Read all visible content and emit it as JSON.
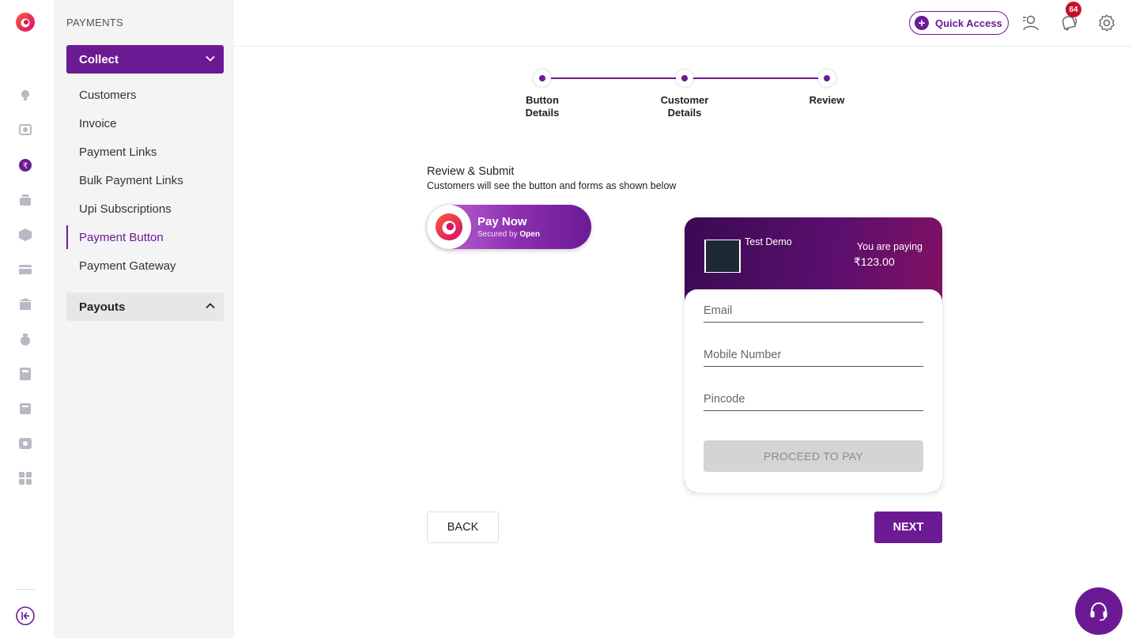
{
  "sidebar": {
    "heading": "PAYMENTS",
    "collect_label": "Collect",
    "items": [
      {
        "label": "Customers"
      },
      {
        "label": "Invoice"
      },
      {
        "label": "Payment Links"
      },
      {
        "label": "Bulk Payment Links"
      },
      {
        "label": "Upi Subscriptions"
      },
      {
        "label": "Payment Button",
        "active": true
      },
      {
        "label": "Payment Gateway"
      }
    ],
    "payouts_label": "Payouts"
  },
  "rail": {
    "icons": [
      "bulb-icon",
      "search-profile-icon",
      "rupee-icon",
      "basket-icon",
      "box-icon",
      "card-icon",
      "bank-icon",
      "money-bag-icon",
      "calculator-icon",
      "ledger-icon",
      "reward-icon",
      "grid-icon"
    ],
    "active_icon": "rupee-icon"
  },
  "topbar": {
    "quick_access_label": "Quick Access",
    "notification_count": "64"
  },
  "stepper": {
    "steps": [
      {
        "label_line1": "Button",
        "label_line2": "Details"
      },
      {
        "label_line1": "Customer",
        "label_line2": "Details"
      },
      {
        "label_line1": "Review",
        "label_line2": ""
      }
    ]
  },
  "review": {
    "title": "Review & Submit",
    "subtitle": "Customers will see the button and forms as shown below"
  },
  "pay_button": {
    "label": "Pay Now",
    "secured_prefix": "Secured by",
    "secured_brand": "Open"
  },
  "checkout": {
    "merchant_name": "Test Demo",
    "paying_label": "You are paying",
    "amount": "₹123.00",
    "email_placeholder": "Email",
    "mobile_placeholder": "Mobile Number",
    "pincode_placeholder": "Pincode",
    "proceed_label": "PROCEED TO PAY"
  },
  "actions": {
    "back_label": "BACK",
    "next_label": "NEXT"
  },
  "colors": {
    "brand": "#6c1a94",
    "badge": "#c8102e",
    "logo_accent": "#e0105e"
  }
}
